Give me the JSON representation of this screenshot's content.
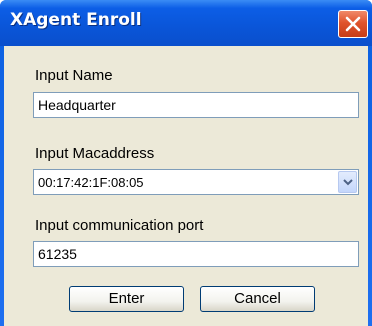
{
  "window": {
    "title": "XAgent Enroll"
  },
  "form": {
    "name_label": "Input Name",
    "name_value": "Headquarter",
    "mac_label": "Input Macaddress",
    "mac_value": "00:17:42:1F:08:05",
    "port_label": "Input communication port",
    "port_value": "61235"
  },
  "buttons": {
    "enter_label": "Enter",
    "cancel_label": "Cancel"
  },
  "icons": {
    "close": "close-icon",
    "dropdown": "chevron-down-icon"
  },
  "colors": {
    "titlebar": "#0a55d8",
    "client_bg": "#ece9d8",
    "close_button": "#e0542d",
    "field_border": "#7f9db9"
  }
}
